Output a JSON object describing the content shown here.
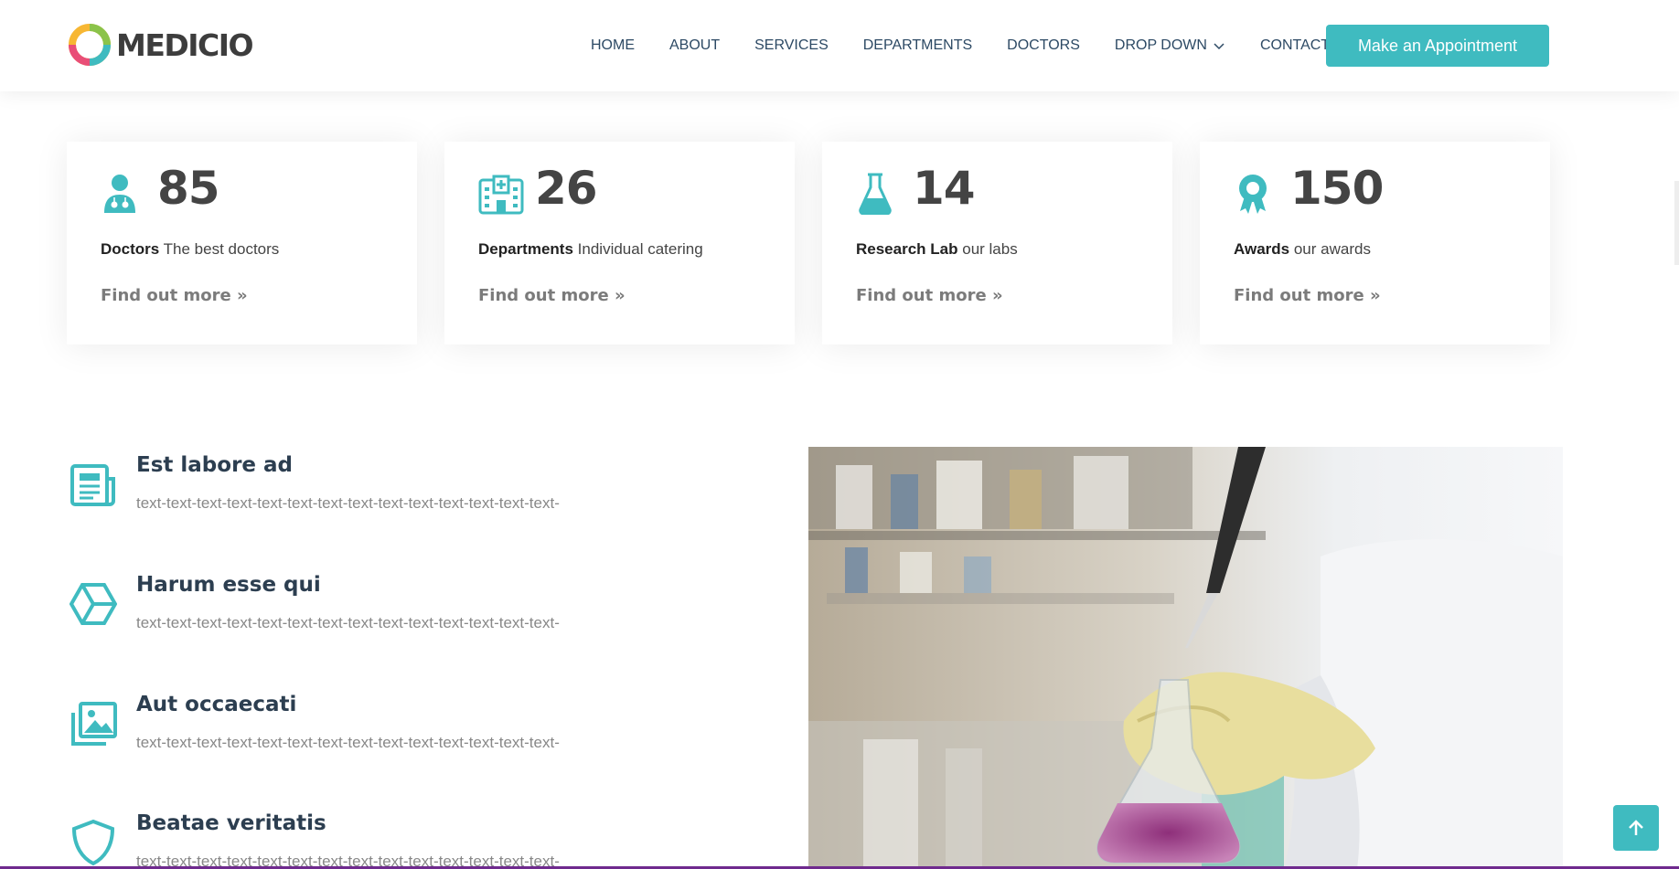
{
  "header": {
    "brand": "MEDICIO",
    "nav": [
      {
        "label": "HOME"
      },
      {
        "label": "ABOUT"
      },
      {
        "label": "SERVICES"
      },
      {
        "label": "DEPARTMENTS"
      },
      {
        "label": "DOCTORS"
      },
      {
        "label": "DROP DOWN"
      },
      {
        "label": "CONTACT"
      }
    ],
    "appointment_label": "Make an Appointment"
  },
  "stats": [
    {
      "icon": "doctor-icon",
      "number": "85",
      "title": "Doctors",
      "text": "The best doctors",
      "link": "Find out more »"
    },
    {
      "icon": "hospital-icon",
      "number": "26",
      "title": "Departments",
      "text": "Individual catering",
      "link": "Find out more »"
    },
    {
      "icon": "flask-icon",
      "number": "14",
      "title": "Research Lab",
      "text": "our labs",
      "link": "Find out more »"
    },
    {
      "icon": "award-icon",
      "number": "150",
      "title": "Awards",
      "text": "our awards",
      "link": "Find out more »"
    }
  ],
  "features": [
    {
      "icon": "newspaper-icon",
      "title": "Est labore ad",
      "text": "text-text-text-text-text-text-text-text-text-text-text-text-text-text-"
    },
    {
      "icon": "box-icon",
      "title": "Harum esse qui",
      "text": "text-text-text-text-text-text-text-text-text-text-text-text-text-text-"
    },
    {
      "icon": "images-icon",
      "title": "Aut occaecati",
      "text": "text-text-text-text-text-text-text-text-text-text-text-text-text-text-"
    },
    {
      "icon": "shield-icon",
      "title": "Beatae veritatis",
      "text": "text-text-text-text-text-text-text-text-text-text-text-text-text-text-"
    }
  ],
  "colors": {
    "accent": "#3fbbc0",
    "nav_text": "#2c4964",
    "heading": "#2c3e50"
  }
}
